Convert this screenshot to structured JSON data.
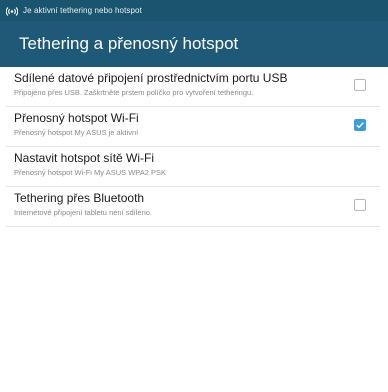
{
  "status_bar": {
    "icon": "hotspot-icon",
    "text": "Je aktivní tethering nebo hotspot"
  },
  "action_bar": {
    "title": "Tethering a přenosný hotspot"
  },
  "settings": [
    {
      "title": "Sdílené datové připojení prostřednictvím portu USB",
      "subtitle": "Připojeno přes USB. Zaškrtněte prstem políčko pro vytvoření tetheringu.",
      "control": "checkbox",
      "checked": false
    },
    {
      "title": "Přenosný hotspot Wi-Fi",
      "subtitle": "Přenosný hotspot My ASUS je aktivní",
      "control": "checkbox",
      "checked": true
    },
    {
      "title": "Nastavit hotspot sítě Wi-Fi",
      "subtitle": "Přenosný hotspot Wi-Fi My ASUS WPA2 PSK",
      "control": "none"
    },
    {
      "title": "Tethering přes Bluetooth",
      "subtitle": "Internetové připojení tabletu není sdíleno.",
      "control": "checkbox",
      "checked": false
    }
  ],
  "colors": {
    "status_bar": "#1a5570",
    "action_bar": "#1e5a78",
    "accent": "#3a9fd8"
  }
}
